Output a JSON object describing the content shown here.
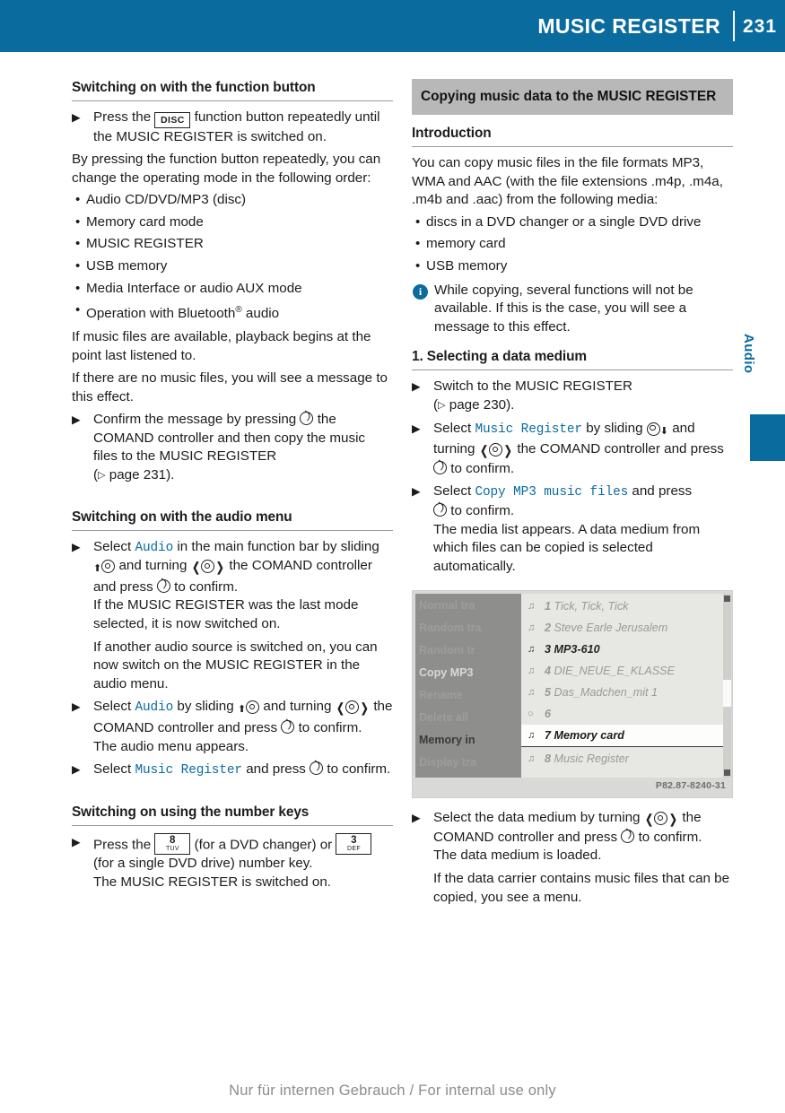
{
  "header": {
    "title": "MUSIC REGISTER",
    "page_number": "231"
  },
  "side_tab": {
    "label": "Audio"
  },
  "left_column": {
    "heading_1": "Switching on with the function button",
    "step_1": {
      "text_before": "Press the",
      "key_label": "DISC",
      "text_after": "function button repeatedly until the MUSIC REGISTER is switched on."
    },
    "para_1": "By pressing the function button repeatedly, you can change the operating mode in the following order:",
    "bullets": [
      "Audio CD/DVD/MP3 (disc)",
      "Memory card mode",
      "MUSIC REGISTER",
      "USB memory",
      "Media Interface or audio AUX mode"
    ],
    "bullet_bluetooth_pre": "Operation with Bluetooth",
    "bullet_bluetooth_sup": "®",
    "bullet_bluetooth_post": " audio",
    "para_2": "If music files are available, playback begins at the point last listened to.",
    "para_3": "If there are no music files, you will see a message to this effect.",
    "step_2": {
      "part_a": "Confirm the message by pressing",
      "part_b": "the COMAND controller and then copy the music files to the MUSIC REGISTER",
      "page_ref": "page 231)."
    },
    "heading_2": "Switching on with the audio menu",
    "step_3": {
      "part_a": "Select",
      "highlight": "Audio",
      "part_b": "in the main function bar by sliding",
      "part_c": "and turning",
      "part_d": "the COMAND controller and press",
      "part_e": "to confirm.",
      "cont_1": "If the MUSIC REGISTER was the last mode selected, it is now switched on.",
      "cont_2": "If another audio source is switched on, you can now switch on the MUSIC REGISTER in the audio menu."
    },
    "step_4": {
      "part_a": "Select",
      "highlight": "Audio",
      "part_b": "by sliding",
      "part_c": "and turning",
      "part_d": "the COMAND controller and press",
      "part_e": "to confirm.",
      "cont_1": "The audio menu appears."
    },
    "step_5": {
      "part_a": "Select",
      "highlight": "Music Register",
      "part_b": "and press",
      "part_c": "to confirm."
    },
    "heading_3": "Switching on using the number keys",
    "step_6": {
      "part_a": "Press the",
      "key1_main": "8",
      "key1_sub": "TUV",
      "part_b": "(for a DVD changer) or",
      "key2_main": "3",
      "key2_sub": "DEF",
      "part_c": "(for a single DVD drive) number key.",
      "cont_1": "The MUSIC REGISTER is switched on."
    }
  },
  "right_column": {
    "section_band": "Copying music data to the MUSIC REGISTER",
    "heading_intro": "Introduction",
    "para_1": "You can copy music files in the file formats MP3, WMA and AAC (with the file extensions .m4p, .m4a, .m4b and .aac) from the following media:",
    "bullets": [
      "discs in a DVD changer or a single DVD drive",
      "memory card",
      "USB memory"
    ],
    "note_1": "While copying, several functions will not be available. If this is the case, you will see a message to this effect.",
    "heading_step1": "1. Selecting a data medium",
    "step_1": {
      "part_a": "Switch to the MUSIC REGISTER",
      "page_ref": "page 230)."
    },
    "step_2": {
      "part_a": "Select",
      "highlight": "Music Register",
      "part_b": "by sliding",
      "part_c": "and turning",
      "part_d": "the COMAND controller and press",
      "part_e": "to confirm."
    },
    "step_3": {
      "part_a": "Select",
      "highlight": "Copy MP3 music files",
      "part_b": "and press",
      "part_c": "to confirm.",
      "cont_1": "The media list appears. A data medium from which files can be copied is selected automatically."
    },
    "figure": {
      "menu_items": [
        "Normal tra",
        "Random tra",
        "Random tr",
        "Copy MP3",
        "Rename",
        "Delete all",
        "Memory in",
        "Display tra"
      ],
      "selected_menu_item": "Copy MP3",
      "list_rows": [
        {
          "num": "1",
          "label": "Tick, Tick, Tick",
          "state": "dim"
        },
        {
          "num": "2",
          "label": "Steve Earle   Jerusalem",
          "state": "dim"
        },
        {
          "num": "3",
          "label": "MP3-610",
          "state": "strong"
        },
        {
          "num": "4",
          "label": "DIE_NEUE_E_KLASSE",
          "state": "dim"
        },
        {
          "num": "5",
          "label": "Das_Madchen_mit 1",
          "state": "dim"
        },
        {
          "num": "6",
          "label": "",
          "state": "dim"
        },
        {
          "num": "7",
          "label": "Memory card",
          "state": "selected"
        },
        {
          "num": "8",
          "label": "Music Register",
          "state": "dim"
        }
      ],
      "caption_code": "P82.87-8240-31"
    },
    "step_4": {
      "part_a": "Select the data medium by turning",
      "part_b": "the COMAND controller and press",
      "part_c": "to confirm.",
      "cont_1": "The data medium is loaded.",
      "cont_2": "If the data carrier contains music files that can be copied, you see a menu."
    }
  },
  "footer": {
    "watermark": "Nur für internen Gebrauch / For internal use only"
  }
}
